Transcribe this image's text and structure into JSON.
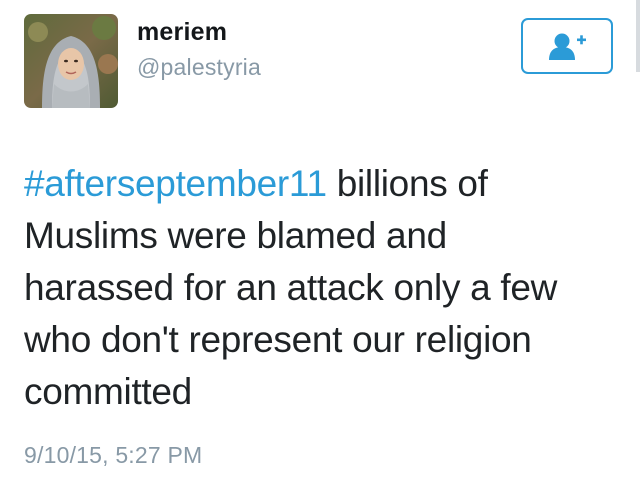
{
  "user": {
    "display_name": "meriem",
    "handle": "@palestyria",
    "avatar_icon": "profile-photo"
  },
  "follow_button": {
    "icon": "add-user-icon",
    "color": "#2b9bd7"
  },
  "tweet": {
    "hashtag": "#afterseptember11",
    "text_line1_rest": " billions of",
    "text_line2": "Muslims were blamed and",
    "text_line3": "harassed for an attack only a few",
    "text_line4": "who don't represent our religion",
    "text_line5": "committed",
    "timestamp": "9/10/15, 5:27 PM"
  },
  "colors": {
    "link": "#2b9bd7",
    "muted": "#8899a6",
    "text": "#1f2326"
  }
}
